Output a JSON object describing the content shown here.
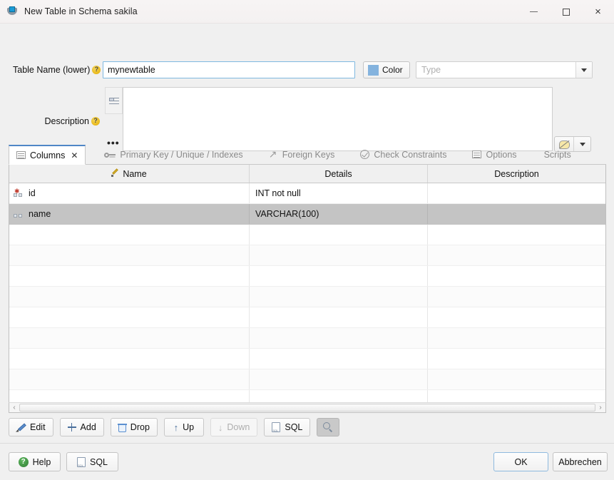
{
  "window": {
    "title": "New Table in Schema sakila",
    "icon": "database-table-icon",
    "minimize_label": "",
    "maximize_label": "",
    "close_label": "×"
  },
  "form": {
    "table_name_label": "Table Name (lower)",
    "table_name_value": "mynewtable",
    "description_label": "Description",
    "color_button_label": "Color",
    "color_swatch_hex": "#84b3de",
    "type_placeholder": "Type",
    "type_value": "",
    "description_value": "",
    "description_dots": "•••"
  },
  "tabs": [
    {
      "label": "Columns",
      "icon": "grid-icon",
      "active": true,
      "closable": true,
      "close_label": "✕"
    },
    {
      "label": "Primary Key / Unique / Indexes",
      "icon": "key-icon",
      "active": false,
      "closable": false
    },
    {
      "label": "Foreign Keys",
      "icon": "arrow-up-right-icon",
      "active": false,
      "closable": false
    },
    {
      "label": "Check Constraints",
      "icon": "check-circle-icon",
      "active": false,
      "closable": false
    },
    {
      "label": "Options",
      "icon": "list-icon",
      "active": false,
      "closable": false
    },
    {
      "label": "Scripts",
      "icon": "",
      "active": false,
      "closable": false
    }
  ],
  "grid": {
    "columns": [
      {
        "label": "Name",
        "icon": "pencil-icon"
      },
      {
        "label": "Details",
        "icon": ""
      },
      {
        "label": "Description",
        "icon": ""
      }
    ],
    "rows": [
      {
        "name": "id",
        "details": "INT not null",
        "description": "",
        "icon": "column-pk-icon",
        "selected": false
      },
      {
        "name": "name",
        "details": "VARCHAR(100)",
        "description": "",
        "icon": "column-icon",
        "selected": true
      }
    ],
    "empty_row_count": 11
  },
  "toolbar": [
    {
      "label": "Edit",
      "icon": "pencil-icon",
      "disabled": false
    },
    {
      "label": "Add",
      "icon": "plus-icon",
      "disabled": false
    },
    {
      "label": "Drop",
      "icon": "trash-icon",
      "disabled": false
    },
    {
      "label": "Up",
      "icon": "arrow-up-icon",
      "disabled": false
    },
    {
      "label": "Down",
      "icon": "arrow-down-icon",
      "disabled": true
    },
    {
      "label": "SQL",
      "icon": "sql-file-icon",
      "disabled": false
    },
    {
      "label": "",
      "icon": "search-icon",
      "disabled": false
    }
  ],
  "footer": {
    "help_label": "Help",
    "sql_label": "SQL",
    "ok_label": "OK",
    "cancel_label": "Abbrechen"
  },
  "scrollbar": {
    "left_arrow": "‹",
    "right_arrow": "›"
  }
}
